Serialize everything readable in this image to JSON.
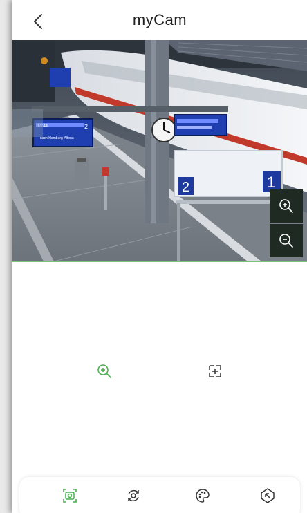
{
  "header": {
    "title": "myCam",
    "back_icon": "chevron-left-icon"
  },
  "video": {
    "platform_sign_left": "2",
    "platform_sign_right": "1",
    "board_left_line1": "13:44",
    "board_left_line2": "2",
    "board_left_line3": "nach Hamburg-Altona",
    "overlay_controls": [
      {
        "name": "zoom-in-icon"
      },
      {
        "name": "zoom-out-icon"
      }
    ]
  },
  "controls": {
    "mid": [
      {
        "name": "zoom-in-icon",
        "active": true
      },
      {
        "name": "focus-frame-icon",
        "active": false
      }
    ],
    "toolbar": [
      {
        "name": "snapshot-frame-icon",
        "active": true
      },
      {
        "name": "rotate-camera-icon",
        "active": false
      },
      {
        "name": "palette-icon",
        "active": false
      },
      {
        "name": "ptz-direction-icon",
        "active": false
      }
    ]
  },
  "colors": {
    "accent": "#4caf50",
    "icon": "#333333",
    "overlay_bg": "#1f2b22"
  }
}
